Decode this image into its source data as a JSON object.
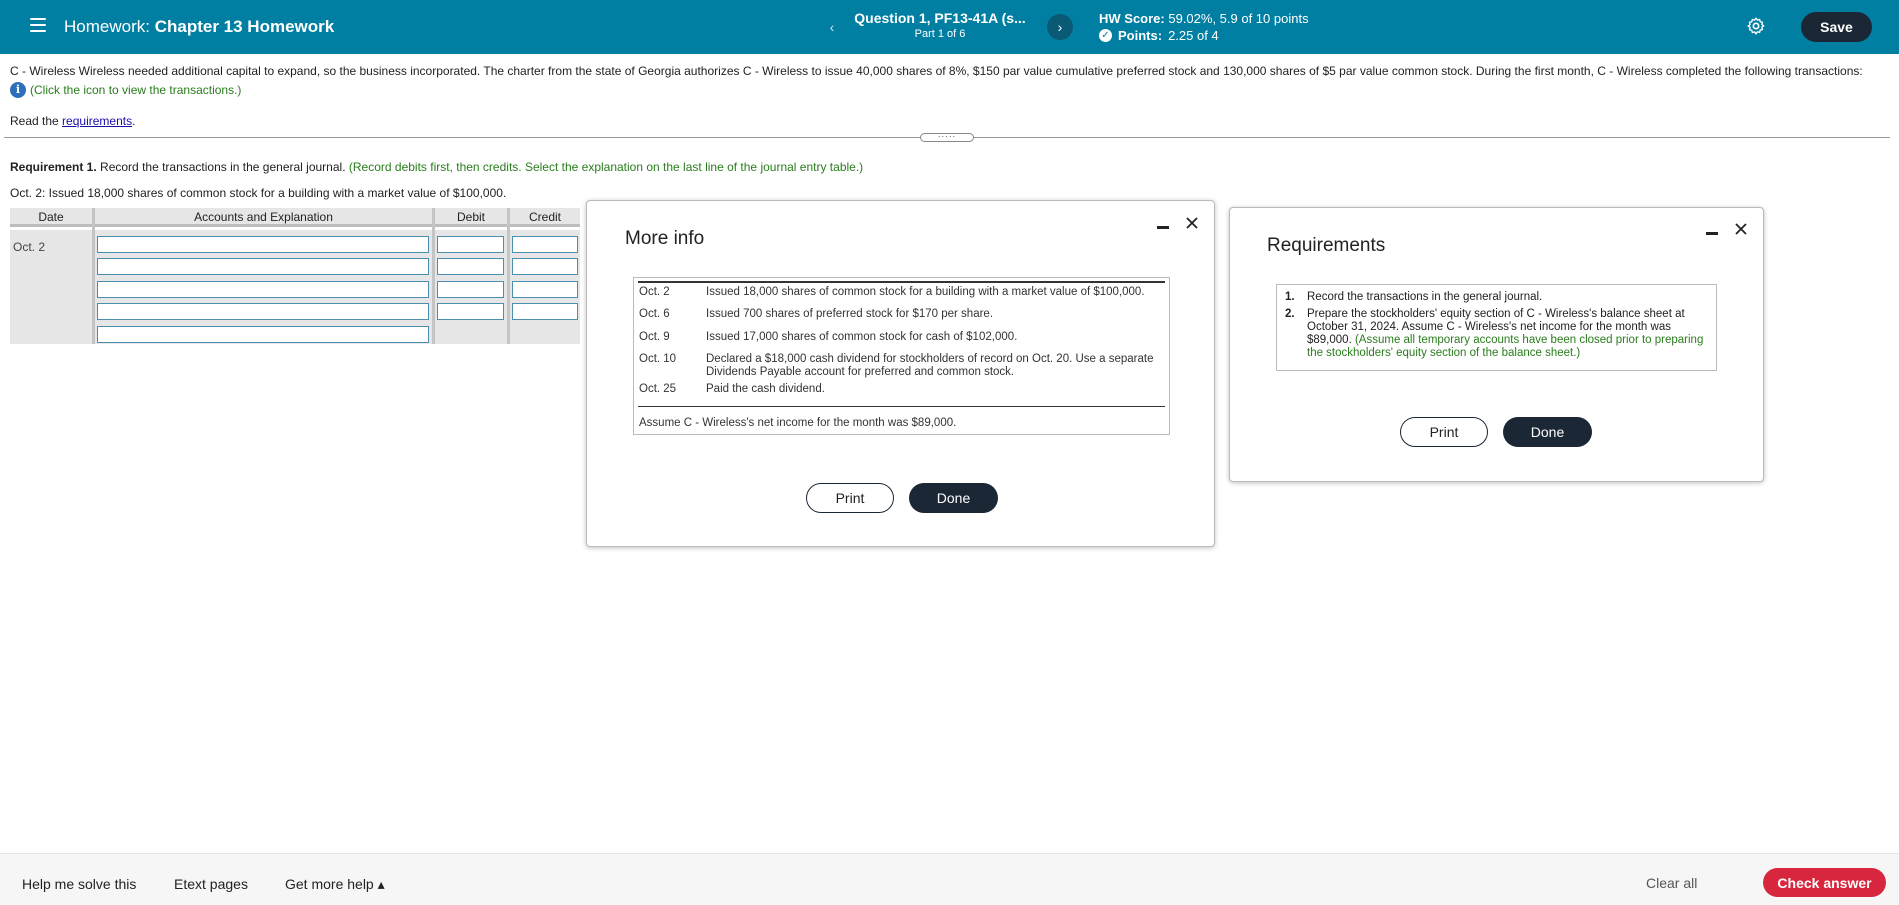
{
  "header": {
    "label": "Homework:",
    "title": "Chapter 13 Homework",
    "question_title": "Question 1, PF13-41A (s...",
    "question_part": "Part 1 of 6",
    "prev_label": "‹",
    "next_label": "›",
    "hw_score_label": "HW Score:",
    "hw_score_value": "59.02%, 5.9 of 10 points",
    "points_label": "Points:",
    "points_value": "2.25 of 4",
    "save_label": "Save"
  },
  "problem": {
    "text": "C - Wireless Wireless needed additional capital to expand, so the business incorporated. The charter from the state of Georgia authorizes C - Wireless to issue 40,000 shares of 8%, $150 par value cumulative preferred stock and 130,000 shares of $5 par value common stock. During the first month, C - Wireless completed the following transactions:",
    "hint": "(Click the icon to view the transactions.)",
    "read_prefix": "Read the",
    "read_link": "requirements",
    "read_suffix": "."
  },
  "requirement1": {
    "label": "Requirement 1.",
    "text": "Record the transactions in the general journal.",
    "note": "(Record debits first, then credits. Select the explanation on the last line of the journal entry table.)",
    "transaction": "Oct. 2: Issued 18,000 shares of common stock for a building with a market value of $100,000."
  },
  "journal": {
    "headers": [
      "Date",
      "Accounts and Explanation",
      "Debit",
      "Credit"
    ],
    "date": "Oct. 2"
  },
  "more_info": {
    "title": "More info",
    "transactions": [
      {
        "date": "Oct. 2",
        "desc": "Issued 18,000 shares of common stock for a building with a market value of $100,000."
      },
      {
        "date": "Oct. 6",
        "desc": "Issued 700 shares of preferred stock for $170 per share."
      },
      {
        "date": "Oct. 9",
        "desc": "Issued 17,000 shares of common stock for cash of $102,000."
      },
      {
        "date": "Oct. 10",
        "desc": "Declared a $18,000 cash dividend for stockholders of record on Oct. 20. Use a separate Dividends Payable account for preferred and common stock."
      },
      {
        "date": "Oct. 25",
        "desc": "Paid the cash dividend."
      }
    ],
    "net_income": "Assume C - Wireless's net income for the month was $89,000.",
    "print_label": "Print",
    "done_label": "Done"
  },
  "requirements": {
    "title": "Requirements",
    "items": [
      {
        "num": "1.",
        "text": "Record the transactions in the general journal.",
        "note": ""
      },
      {
        "num": "2.",
        "text": "Prepare the stockholders' equity section of C - Wireless's balance sheet at October 31, 2024. Assume C - Wireless's net income for the month was $89,000.",
        "note": "(Assume all temporary accounts have been closed prior to preparing the stockholders' equity section of the balance sheet.)"
      }
    ],
    "print_label": "Print",
    "done_label": "Done"
  },
  "footer": {
    "help_solve": "Help me solve this",
    "etext": "Etext pages",
    "more_help": "Get more help ▴",
    "clear_all": "Clear all",
    "check_answer": "Check answer"
  }
}
